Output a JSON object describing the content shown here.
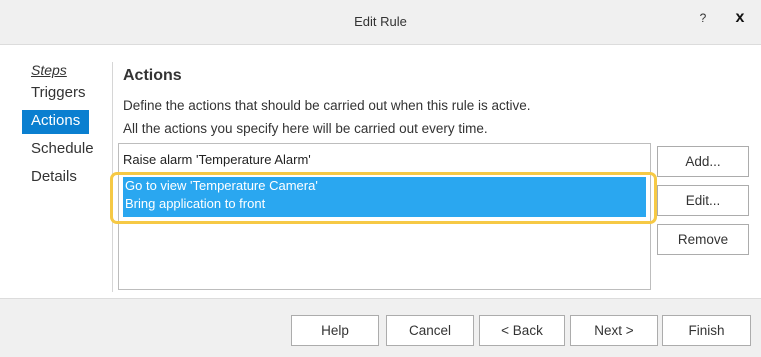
{
  "window": {
    "title": "Edit Rule",
    "help_glyph": "?",
    "close_glyph": "x"
  },
  "steps": {
    "header": "Steps",
    "items": [
      {
        "label": "Triggers",
        "active": false
      },
      {
        "label": "Actions",
        "active": true
      },
      {
        "label": "Schedule",
        "active": false
      },
      {
        "label": "Details",
        "active": false
      }
    ]
  },
  "content": {
    "heading": "Actions",
    "description_line1": "Define the actions that should be carried out when this rule is active.",
    "description_line2": "All the actions you specify here will be carried out every time.",
    "actions": [
      {
        "lines": [
          "Raise alarm 'Temperature Alarm'"
        ],
        "selected": false
      },
      {
        "lines": [
          "Go to view 'Temperature Camera'",
          "Bring application to front"
        ],
        "selected": true
      }
    ]
  },
  "side_buttons": {
    "add": "Add...",
    "edit": "Edit...",
    "remove": "Remove"
  },
  "footer": {
    "help": "Help",
    "cancel": "Cancel",
    "back": "< Back",
    "next": "Next >",
    "finish": "Finish"
  },
  "colors": {
    "active_step": "#0a7fd0",
    "selection": "#2aa7f0",
    "highlight_ring": "#f6c945"
  }
}
